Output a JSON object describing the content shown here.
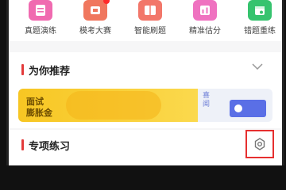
{
  "quick_actions": [
    {
      "label": "真题演练",
      "color": "#f06ab0",
      "icon": "paper-icon"
    },
    {
      "label": "模考大赛",
      "color": "#f0775e",
      "icon": "trophy-icon",
      "badge": true
    },
    {
      "label": "智能刷题",
      "color": "#f2776a",
      "icon": "book-icon"
    },
    {
      "label": "精准估分",
      "color": "#ef72c0",
      "icon": "score-icon"
    },
    {
      "label": "错题重练",
      "color": "#36c36e",
      "icon": "calendar-icon"
    }
  ],
  "recommend": {
    "title": "为你推荐"
  },
  "banner": {
    "line1": "面试",
    "line2": "膨胀金",
    "news": "喜\n闻"
  },
  "special": {
    "title": "专项练习"
  },
  "accent": "#e33b3b"
}
